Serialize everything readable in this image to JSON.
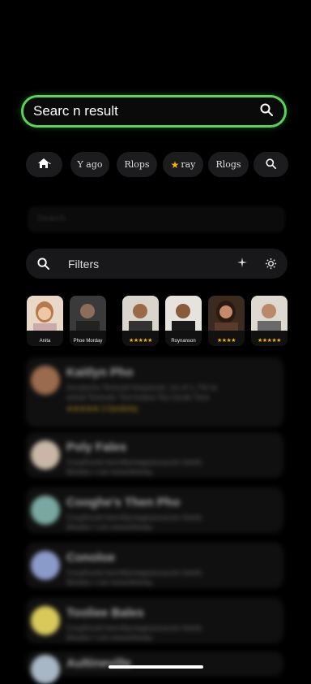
{
  "search": {
    "query": "Searc n result"
  },
  "chips": [
    {
      "label": ""
    },
    {
      "label": "Y ago"
    },
    {
      "label": "Rlops"
    },
    {
      "label": "ray"
    },
    {
      "label": "Rlogs"
    },
    {
      "label": ""
    }
  ],
  "blurred_input": {
    "placeholder": "Search"
  },
  "filters": {
    "label": "Filters"
  },
  "avatars": [
    {
      "caption": "Anita",
      "stars": false,
      "color": "#d8a06a"
    },
    {
      "caption": "Phoe Morday",
      "stars": false,
      "color": "#4b4b4b"
    },
    {
      "caption": "★★★★★",
      "stars": true,
      "color": "#6b4b35"
    },
    {
      "caption": "Roynanson",
      "stars": false,
      "color": "#4a3526"
    },
    {
      "caption": "★★★★",
      "stars": true,
      "color": "#5a2c1a"
    },
    {
      "caption": "★★★★★",
      "stars": true,
      "color": "#8b7a68"
    }
  ],
  "results": [
    {
      "title": "Kaitlyn Pho",
      "line1": "Ancytecho Textuuid frequenuls, mu of 1, Fill no",
      "line2": "astudi Textuuid, Toxt kvalua Tea Gerab Tiere",
      "rating": "★★★★★  3 Genilmhy",
      "avatar_color": "#9a6b4e"
    },
    {
      "title": "Poly Fales",
      "line1": "Couplhuvtd lwomltiyreagiueovavstv Adults",
      "line2": "Moobtu • Lits treoesthenky",
      "rating": "",
      "avatar_color": "#c8b7a6"
    },
    {
      "title": "Cooghe's Then Pho",
      "line1": "Couplhuvtd lwomltiyreagiueovavstv Adults",
      "line2": "Moobtu • Lits treoesthenky",
      "rating": "",
      "avatar_color": "#7aa7a0"
    },
    {
      "title": "Conoloe",
      "line1": "Couplhuvtd lwomltiyreagiueovavstv Adults",
      "line2": "Moobtu • Lits treoesthenky",
      "rating": "",
      "avatar_color": "#8b9bc9"
    },
    {
      "title": "Tooliee Bales",
      "line1": "Couplhuvtd lwomltiyreagiueovavstv Adults",
      "line2": "Moobtu • Lits treoesthenky",
      "rating": "",
      "avatar_color": "#d8c95a"
    },
    {
      "title": "Aultineville",
      "line1": "",
      "line2": "",
      "rating": "",
      "avatar_color": "#a8b7c5"
    }
  ]
}
